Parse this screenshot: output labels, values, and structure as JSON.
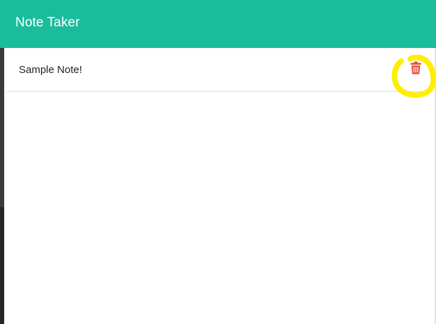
{
  "navbar": {
    "title": "Note Taker",
    "color": "#1abc9c"
  },
  "notes": [
    {
      "title": "Sample Note!",
      "delete_icon": "trash-icon",
      "delete_color": "#e74c3c"
    }
  ],
  "annotation": {
    "type": "hand-drawn-circle",
    "color": "#ffee00",
    "target": "trash-icon"
  }
}
